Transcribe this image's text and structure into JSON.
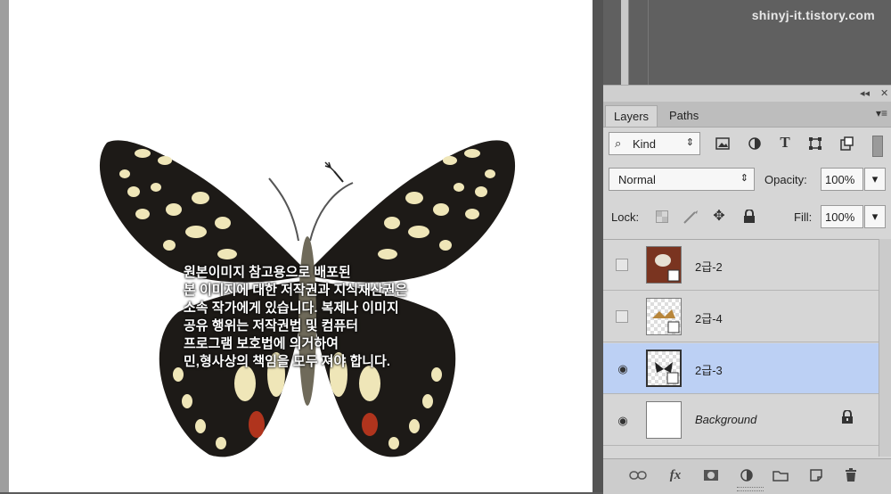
{
  "watermark": "shinyj-it.tistory.com",
  "canvas": {
    "caption_lines": [
      "원본이미지 참고용으로 배포된",
      "본 이미지에 대한 저작권과 지식재산권은",
      "소속 작가에게 있습니다. 복제나 이미지",
      "공유 행위는 저작권법 및 컴퓨터",
      "프로그램 보호법에 의거하여",
      "민,형사상의 책임을 모두 져야 합니다."
    ]
  },
  "panel": {
    "collapse_glyph": "◂◂",
    "close_glyph": "✕",
    "tabs": [
      {
        "label": "Layers"
      },
      {
        "label": "Paths"
      }
    ],
    "tab_menu_glyph": "▾≡",
    "filter": {
      "label": "Kind",
      "prefix_glyph": "⌕",
      "arrows": "⇕"
    },
    "blend": {
      "mode": "Normal",
      "arrows": "⇕",
      "opacity_label": "Opacity:",
      "opacity_value": "100%",
      "dropdown": "▾"
    },
    "lock": {
      "label": "Lock:",
      "fill_label": "Fill:",
      "fill_value": "100%",
      "dropdown": "▾"
    },
    "layers": [
      {
        "name": "2급-2",
        "visible": false,
        "selected": false
      },
      {
        "name": "2급-4",
        "visible": false,
        "selected": false
      },
      {
        "name": "2급-3",
        "visible": true,
        "selected": true
      },
      {
        "name": "Background",
        "visible": true,
        "selected": false,
        "locked": true
      }
    ],
    "eye_glyph": "◉",
    "lock_glyph": "🔒",
    "footer": {
      "fx_label": "fx"
    },
    "colors": {
      "selected_row": "#bcd0f4",
      "panel_bg": "#d6d6d6"
    }
  }
}
